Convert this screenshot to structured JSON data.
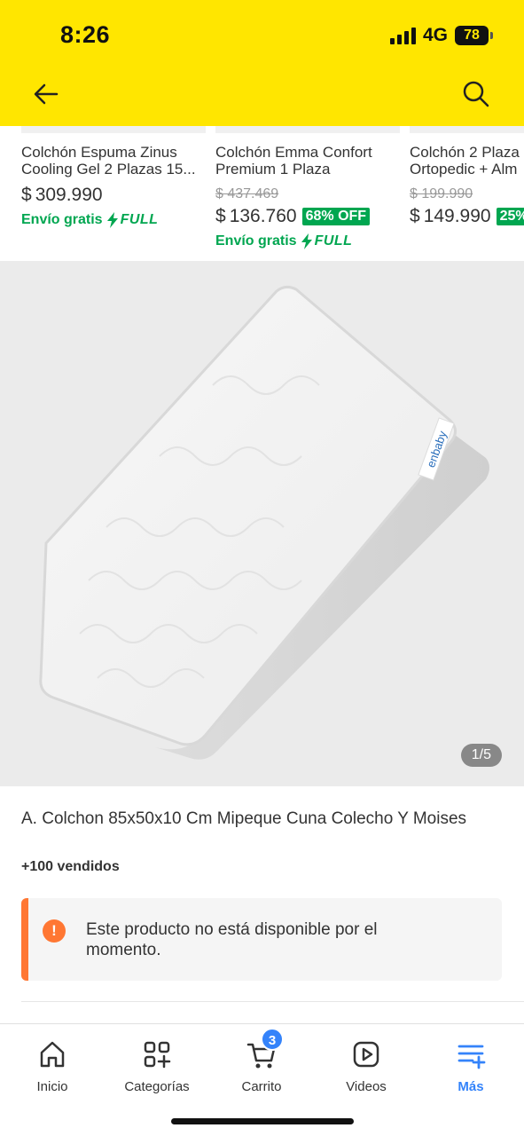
{
  "status_bar": {
    "time": "8:26",
    "network": "4G",
    "battery": "78"
  },
  "header": {
    "back_icon": "arrow-left-icon",
    "search_icon": "search-icon",
    "background": "#FFE600"
  },
  "recommendations": [
    {
      "title": "Colchón Espuma Zinus\nCooling Gel 2 Plazas 15...",
      "old_price": "",
      "currency": "$",
      "price": "309.990",
      "discount": "",
      "shipping": "Envío gratis",
      "full": "FULL"
    },
    {
      "title": "Colchón Emma Confort\nPremium 1 Plaza",
      "old_price": "$ 437.469",
      "currency": "$",
      "price": "136.760",
      "discount": "68% OFF",
      "shipping": "Envío gratis",
      "full": "FULL"
    },
    {
      "title": "Colchón 2 Plaza\nOrtopedic + Alm",
      "old_price": "$ 199.990",
      "currency": "$",
      "price": "149.990",
      "discount": "25%",
      "shipping": "",
      "full": ""
    }
  ],
  "gallery": {
    "counter": "1/5",
    "brand_label": "enbaby"
  },
  "product": {
    "title": "A. Colchon 85x50x10 Cm Mipeque Cuna Colecho Y Moises",
    "sold": "+100 vendidos"
  },
  "notice": {
    "icon": "!",
    "text": "Este producto no está disponible por el momento."
  },
  "bottom_nav": {
    "items": [
      {
        "label": "Inicio",
        "icon": "home-icon"
      },
      {
        "label": "Categorías",
        "icon": "categories-icon"
      },
      {
        "label": "Carrito",
        "icon": "cart-icon",
        "badge": "3"
      },
      {
        "label": "Videos",
        "icon": "video-icon"
      },
      {
        "label": "Más",
        "icon": "more-icon"
      }
    ]
  },
  "colors": {
    "accent_yellow": "#FFE600",
    "green": "#00A650",
    "blue": "#3483FA",
    "warning_orange": "#FF7733"
  }
}
